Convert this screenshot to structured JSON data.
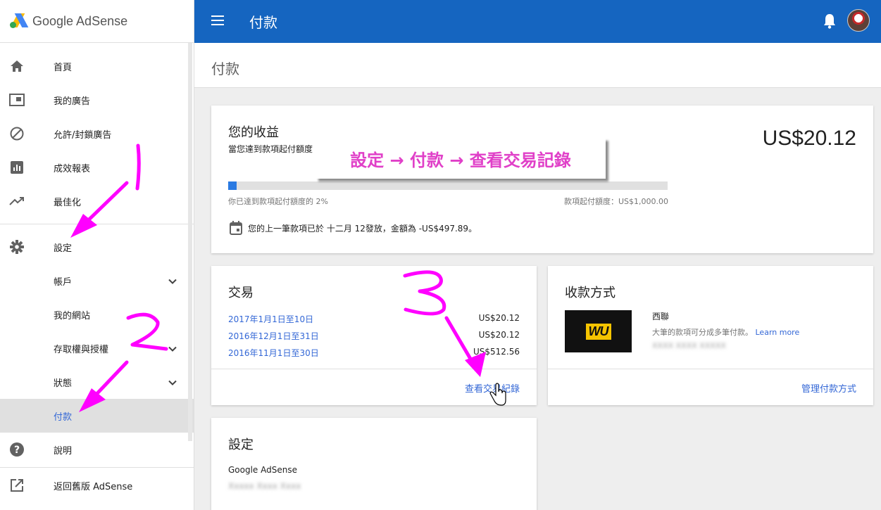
{
  "app": {
    "logo_text": "Google AdSense"
  },
  "sidebar": {
    "items": [
      {
        "label": "首頁",
        "icon": "home-icon"
      },
      {
        "label": "我的廣告",
        "icon": "ad-unit-icon"
      },
      {
        "label": "允許/封鎖廣告",
        "icon": "block-icon"
      },
      {
        "label": "成效報表",
        "icon": "bar-chart-icon"
      },
      {
        "label": "最佳化",
        "icon": "trending-up-icon"
      },
      {
        "label": "設定",
        "icon": "gear-icon"
      },
      {
        "label": "帳戶",
        "has_chevron": true
      },
      {
        "label": "我的網站"
      },
      {
        "label": "存取權與授權",
        "has_chevron": true
      },
      {
        "label": "狀態",
        "has_chevron": true
      },
      {
        "label": "付款",
        "active": true
      },
      {
        "label": "說明",
        "icon": "help-icon"
      },
      {
        "label": "返回舊版 AdSense",
        "icon": "external-link-icon"
      }
    ]
  },
  "topbar": {
    "title": "付款"
  },
  "page": {
    "title": "付款"
  },
  "earnings": {
    "title": "您的收益",
    "subtitle": "當您達到款項起付額度",
    "amount": "US$20.12",
    "progress_fraction": 0.02,
    "progress_label": "你已達到款項起付額度的 2%",
    "threshold_label": "款項起付額度：US$1,000.00",
    "last_payment": "您的上一筆款項已於 十二月 12發放，金額為 -US$497.89。"
  },
  "transactions": {
    "title": "交易",
    "rows": [
      {
        "period": "2017年1月1日至10日",
        "amount": "US$20.12"
      },
      {
        "period": "2016年12月1日至31日",
        "amount": "US$20.12"
      },
      {
        "period": "2016年11月1日至30日",
        "amount": "US$512.56"
      }
    ],
    "view_link": "查看交易紀錄"
  },
  "payment_method": {
    "title": "收款方式",
    "logo_text": "WU",
    "name": "西聯",
    "description": "大筆的款項可分成多筆付款。",
    "learn_more": "Learn more",
    "account_blurred": "XXXX XXXX XXXXX",
    "manage_link": "管理付款方式"
  },
  "settings": {
    "title": "設定",
    "product": "Google AdSense",
    "name_blurred": "Xxxxx Xxxx Xxxx"
  },
  "annotations": {
    "banner": "設定 → 付款 → 查看交易記錄",
    "step1": "1",
    "step2": "2",
    "step3": "3",
    "color": "#ff00ff"
  },
  "colors": {
    "topbar": "#1565c0",
    "link": "#3367d6",
    "progress_fill": "#2a7ae2",
    "wu_yellow": "#f5c400"
  }
}
